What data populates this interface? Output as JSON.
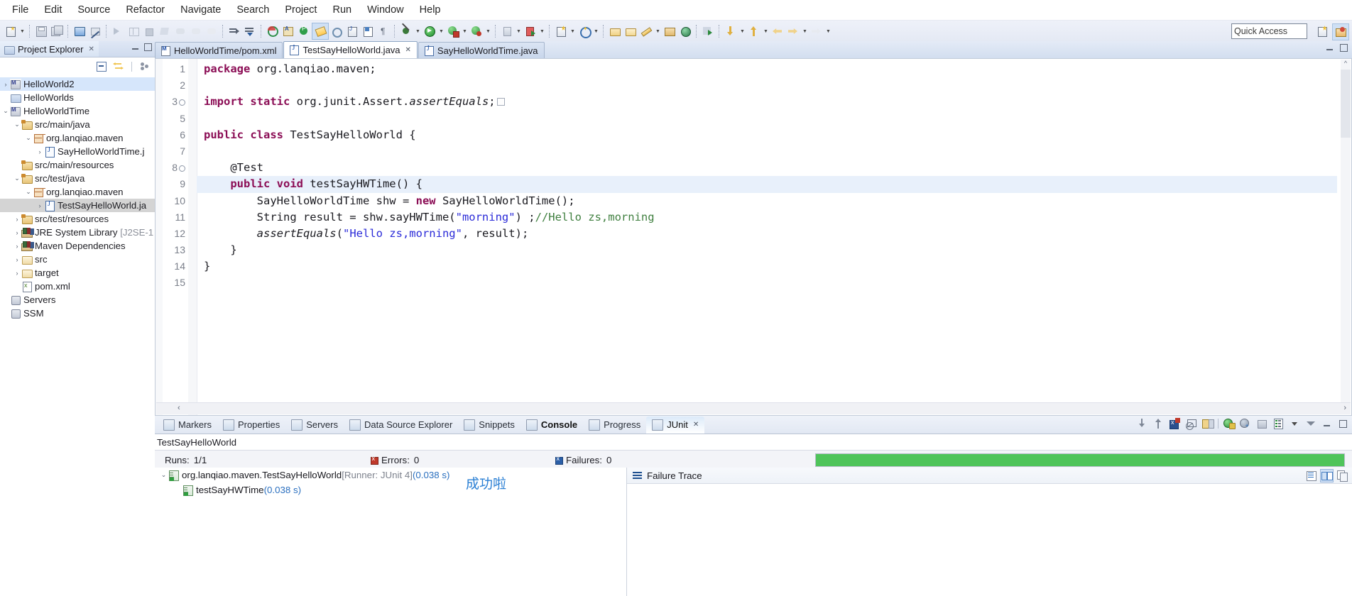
{
  "menubar": {
    "items": [
      "File",
      "Edit",
      "Source",
      "Refactor",
      "Navigate",
      "Search",
      "Project",
      "Run",
      "Window",
      "Help"
    ]
  },
  "toolbar": {
    "quick_access_placeholder": "Quick Access",
    "icons": [
      "new-wizard-icon",
      "new-dropdown-icon",
      "save-icon",
      "save-all-icon",
      "print-icon",
      "toggle-markoccurrences-icon",
      "run-last-tool-icon",
      "open-task-icon",
      "terminate-icon",
      "skip-breakpoints-icon",
      "next-annotation-icon",
      "previous-annotation-icon",
      "back-icon",
      "open-type-icon",
      "search-icon",
      "debug-icon",
      "run-icon",
      "coverage-icon",
      "external-tools-icon",
      "new-java-project-icon",
      "new-class-icon",
      "new-package-icon",
      "open-perspective-icon"
    ]
  },
  "explorer": {
    "title": "Project Explorer",
    "close_glyph": "✕",
    "toolbar_icons": [
      "collapse-all-icon",
      "link-with-editor-icon",
      "view-menu-icon"
    ],
    "tree": [
      {
        "label": "HelloWorld2",
        "indent": 0,
        "twisty": "collapsed",
        "icon": "maven-project-icon",
        "selected": "blue"
      },
      {
        "label": "HelloWorlds",
        "indent": 0,
        "twisty": "none",
        "icon": "closed-project-icon",
        "selected": ""
      },
      {
        "label": "HelloWorldTime",
        "indent": 0,
        "twisty": "expanded",
        "icon": "maven-project-icon",
        "selected": ""
      },
      {
        "label": "src/main/java",
        "indent": 1,
        "twisty": "expanded",
        "icon": "source-folder-icon",
        "selected": ""
      },
      {
        "label": "org.lanqiao.maven",
        "indent": 2,
        "twisty": "expanded",
        "icon": "package-icon",
        "selected": ""
      },
      {
        "label": "SayHelloWorldTime.j",
        "indent": 3,
        "twisty": "collapsed",
        "icon": "java-file-icon",
        "selected": ""
      },
      {
        "label": "src/main/resources",
        "indent": 1,
        "twisty": "none",
        "icon": "source-folder-icon",
        "selected": ""
      },
      {
        "label": "src/test/java",
        "indent": 1,
        "twisty": "expanded",
        "icon": "source-folder-icon",
        "selected": ""
      },
      {
        "label": "org.lanqiao.maven",
        "indent": 2,
        "twisty": "expanded",
        "icon": "package-icon",
        "selected": ""
      },
      {
        "label": "TestSayHelloWorld.ja",
        "indent": 3,
        "twisty": "collapsed",
        "icon": "java-file-icon",
        "selected": "gray"
      },
      {
        "label": "src/test/resources",
        "indent": 1,
        "twisty": "collapsed",
        "icon": "source-folder-icon",
        "selected": ""
      },
      {
        "label": "JRE System Library",
        "suffix": "[J2SE-1",
        "indent": 1,
        "twisty": "collapsed",
        "icon": "library-icon",
        "selected": ""
      },
      {
        "label": "Maven Dependencies",
        "indent": 1,
        "twisty": "collapsed",
        "icon": "library-icon",
        "selected": ""
      },
      {
        "label": "src",
        "indent": 1,
        "twisty": "collapsed",
        "icon": "folder-icon",
        "selected": ""
      },
      {
        "label": "target",
        "indent": 1,
        "twisty": "collapsed",
        "icon": "folder-icon",
        "selected": ""
      },
      {
        "label": "pom.xml",
        "indent": 1,
        "twisty": "none",
        "icon": "xml-file-icon",
        "selected": ""
      },
      {
        "label": "Servers",
        "indent": 0,
        "twisty": "none",
        "icon": "server-project-icon",
        "selected": ""
      },
      {
        "label": "SSM",
        "indent": 0,
        "twisty": "none",
        "icon": "server-project-icon",
        "selected": ""
      }
    ]
  },
  "editor": {
    "tabs": [
      {
        "label": "HelloWorldTime/pom.xml",
        "icon": "maven-pom-icon",
        "active": false,
        "closable": false
      },
      {
        "label": "TestSayHelloWorld.java",
        "icon": "java-file-icon",
        "active": true,
        "closable": true,
        "close_glyph": "✕"
      },
      {
        "label": "SayHelloWorldTime.java",
        "icon": "java-file-icon",
        "active": false,
        "closable": false
      }
    ],
    "line_numbers": [
      "1",
      "2",
      "3",
      "5",
      "6",
      "7",
      "8",
      "9",
      "10",
      "11",
      "12",
      "13",
      "14",
      "15"
    ],
    "lines": [
      {
        "n": "1",
        "fold": false,
        "highlight": false,
        "tokens": [
          {
            "t": "package",
            "c": "kw"
          },
          {
            "t": " org.lanqiao.maven;",
            "c": "plain"
          }
        ]
      },
      {
        "n": "2",
        "fold": false,
        "highlight": false,
        "tokens": []
      },
      {
        "n": "3",
        "fold": true,
        "highlight": false,
        "tokens": [
          {
            "t": "import static",
            "c": "kw"
          },
          {
            "t": " org.junit.Assert.",
            "c": "plain"
          },
          {
            "t": "assertEquals",
            "c": "ital"
          },
          {
            "t": ";",
            "c": "plain"
          }
        ]
      },
      {
        "n": "5",
        "fold": false,
        "highlight": false,
        "tokens": []
      },
      {
        "n": "6",
        "fold": false,
        "highlight": false,
        "tokens": [
          {
            "t": "public class",
            "c": "kw"
          },
          {
            "t": " TestSayHelloWorld {",
            "c": "plain"
          }
        ]
      },
      {
        "n": "7",
        "fold": false,
        "highlight": false,
        "tokens": []
      },
      {
        "n": "8",
        "fold": true,
        "highlight": false,
        "tokens": [
          {
            "t": "    @Test",
            "c": "plain"
          }
        ]
      },
      {
        "n": "9",
        "fold": false,
        "highlight": true,
        "tokens": [
          {
            "t": "    ",
            "c": "plain"
          },
          {
            "t": "public void",
            "c": "kw"
          },
          {
            "t": " testSayHWTime() {",
            "c": "plain"
          }
        ]
      },
      {
        "n": "10",
        "fold": false,
        "highlight": false,
        "tokens": [
          {
            "t": "        SayHelloWorldTime shw = ",
            "c": "plain"
          },
          {
            "t": "new",
            "c": "kw"
          },
          {
            "t": " SayHelloWorldTime();",
            "c": "plain"
          }
        ]
      },
      {
        "n": "11",
        "fold": false,
        "highlight": false,
        "tokens": [
          {
            "t": "        String result = shw.sayHWTime(",
            "c": "plain"
          },
          {
            "t": "\"morning\"",
            "c": "str"
          },
          {
            "t": ") ;",
            "c": "plain"
          },
          {
            "t": "//Hello zs,morning",
            "c": "cmt"
          }
        ]
      },
      {
        "n": "12",
        "fold": false,
        "highlight": false,
        "tokens": [
          {
            "t": "        ",
            "c": "plain"
          },
          {
            "t": "assertEquals",
            "c": "ital"
          },
          {
            "t": "(",
            "c": "plain"
          },
          {
            "t": "\"Hello zs,morning\"",
            "c": "str"
          },
          {
            "t": ", result);",
            "c": "plain"
          }
        ]
      },
      {
        "n": "13",
        "fold": false,
        "highlight": false,
        "tokens": [
          {
            "t": "    }",
            "c": "plain"
          }
        ]
      },
      {
        "n": "14",
        "fold": false,
        "highlight": false,
        "tokens": [
          {
            "t": "}",
            "c": "plain"
          }
        ]
      },
      {
        "n": "15",
        "fold": false,
        "highlight": false,
        "tokens": []
      }
    ],
    "hscroll_left_glyph": "‹",
    "hscroll_right_glyph": "›",
    "vscroll_up_glyph": "^"
  },
  "bottom_panel": {
    "tabs": [
      {
        "label": "Markers",
        "icon": "markers-icon",
        "active": false,
        "bold": false
      },
      {
        "label": "Properties",
        "icon": "properties-icon",
        "active": false,
        "bold": false
      },
      {
        "label": "Servers",
        "icon": "servers-icon",
        "active": false,
        "bold": false
      },
      {
        "label": "Data Source Explorer",
        "icon": "datasource-icon",
        "active": false,
        "bold": false
      },
      {
        "label": "Snippets",
        "icon": "snippets-icon",
        "active": false,
        "bold": false
      },
      {
        "label": "Console",
        "icon": "console-icon",
        "active": false,
        "bold": true
      },
      {
        "label": "Progress",
        "icon": "progress-icon",
        "active": false,
        "bold": false
      },
      {
        "label": "JUnit",
        "icon": "junit-icon",
        "active": true,
        "bold": false,
        "close_glyph": "✕"
      }
    ],
    "toolbar_icons": [
      "next-failure-icon",
      "previous-failure-icon",
      "show-failures-only-icon",
      "stop-icon",
      "lock-icon",
      "rerun-test-icon",
      "rerun-failed-icon",
      "terminate-icon",
      "history-icon",
      "history-dropdown-icon",
      "view-menu-icon",
      "minimize-icon",
      "maximize-icon"
    ]
  },
  "junit": {
    "title": "TestSayHelloWorld",
    "runs_label": "Runs:",
    "runs_value": "1/1",
    "errors_label": "Errors:",
    "errors_value": "0",
    "failures_label": "Failures:",
    "failures_value": "0",
    "progress_percent": 100,
    "progress_color": "#4fc45a",
    "tree": [
      {
        "twisty": "expanded",
        "name": "org.lanqiao.maven.TestSayHelloWorld",
        "runner": "[Runner: JUnit 4]",
        "time": "(0.038 s)",
        "indent": 0
      },
      {
        "twisty": "none",
        "name": "testSayHWTime",
        "runner": "",
        "time": "(0.038 s)",
        "indent": 1
      }
    ],
    "success_note": "成功啦",
    "failure_trace_title": "Failure Trace",
    "failure_trace_tools": [
      "filter-stack-trace-icon",
      "compare-result-icon",
      "copy-trace-icon"
    ]
  }
}
